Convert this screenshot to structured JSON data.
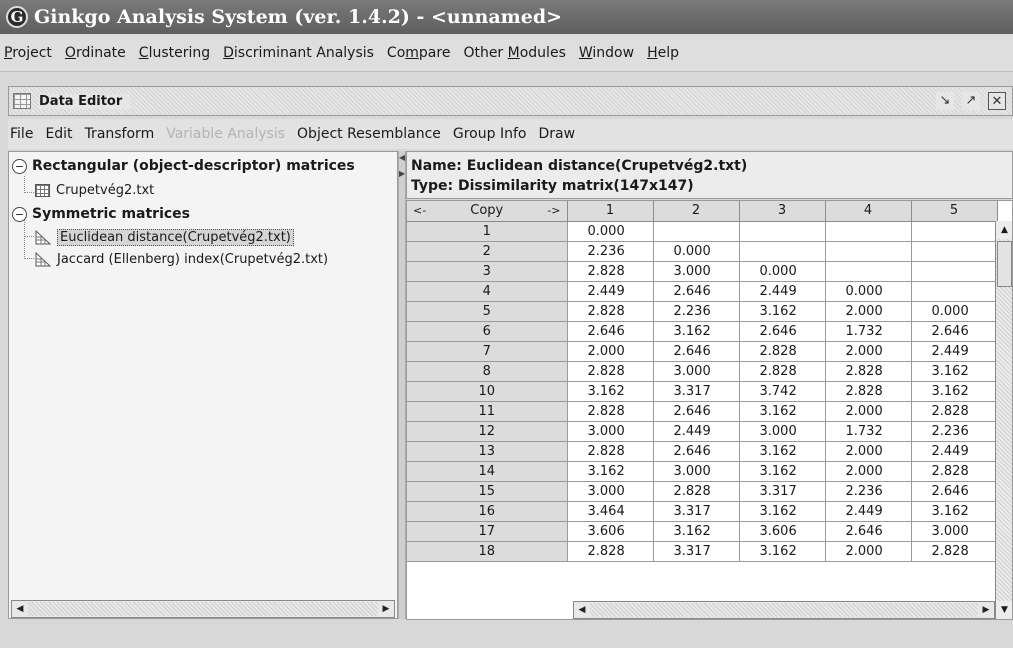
{
  "app": {
    "icon_letter": "G",
    "title": "Ginkgo Analysis System (ver. 1.4.2) - <unnamed>"
  },
  "main_menu": [
    {
      "label": "Project",
      "key": "P"
    },
    {
      "label": "Ordinate",
      "key": "O"
    },
    {
      "label": "Clustering",
      "key": "C"
    },
    {
      "label": "Discriminant Analysis",
      "key": "D"
    },
    {
      "label": "Compare",
      "key": "m"
    },
    {
      "label": "Other Modules",
      "key": "M"
    },
    {
      "label": "Window",
      "key": "W"
    },
    {
      "label": "Help",
      "key": "H"
    }
  ],
  "data_editor": {
    "title": "Data Editor",
    "window_buttons": [
      "minimize",
      "maximize",
      "close"
    ],
    "menu": [
      {
        "label": "File",
        "disabled": false
      },
      {
        "label": "Edit",
        "disabled": false
      },
      {
        "label": "Transform",
        "disabled": false
      },
      {
        "label": "Variable Analysis",
        "disabled": true
      },
      {
        "label": "Object Resemblance",
        "disabled": false
      },
      {
        "label": "Group Info",
        "disabled": false
      },
      {
        "label": "Draw",
        "disabled": false
      }
    ]
  },
  "tree": {
    "categories": [
      {
        "label": "Rectangular (object-descriptor) matrices",
        "items": [
          "Crupetvég2.txt"
        ]
      },
      {
        "label": "Symmetric matrices",
        "items": [
          "Euclidean distance(Crupetvég2.txt)",
          "Jaccard (Ellenberg) index(Crupetvég2.txt)"
        ]
      }
    ],
    "selected_item": "Euclidean distance(Crupetvég2.txt)"
  },
  "matrix": {
    "name_line": "Name: Euclidean distance(Crupetvég2.txt)",
    "type_line": "Type: Dissimilarity matrix(147x147)",
    "nav_left": "<-",
    "copy_label": "Copy",
    "nav_right": "->",
    "columns": [
      "1",
      "2",
      "3",
      "4",
      "5"
    ],
    "rows": [
      {
        "id": "1",
        "values": [
          "0.000",
          "",
          "",
          "",
          ""
        ]
      },
      {
        "id": "2",
        "values": [
          "2.236",
          "0.000",
          "",
          "",
          ""
        ]
      },
      {
        "id": "3",
        "values": [
          "2.828",
          "3.000",
          "0.000",
          "",
          ""
        ]
      },
      {
        "id": "4",
        "values": [
          "2.449",
          "2.646",
          "2.449",
          "0.000",
          ""
        ]
      },
      {
        "id": "5",
        "values": [
          "2.828",
          "2.236",
          "3.162",
          "2.000",
          "0.000"
        ]
      },
      {
        "id": "6",
        "values": [
          "2.646",
          "3.162",
          "2.646",
          "1.732",
          "2.646"
        ]
      },
      {
        "id": "7",
        "values": [
          "2.000",
          "2.646",
          "2.828",
          "2.000",
          "2.449"
        ]
      },
      {
        "id": "8",
        "values": [
          "2.828",
          "3.000",
          "2.828",
          "2.828",
          "3.162"
        ]
      },
      {
        "id": "10",
        "values": [
          "3.162",
          "3.317",
          "3.742",
          "2.828",
          "3.162"
        ]
      },
      {
        "id": "11",
        "values": [
          "2.828",
          "2.646",
          "3.162",
          "2.000",
          "2.828"
        ]
      },
      {
        "id": "12",
        "values": [
          "3.000",
          "2.449",
          "3.000",
          "1.732",
          "2.236"
        ]
      },
      {
        "id": "13",
        "values": [
          "2.828",
          "2.646",
          "3.162",
          "2.000",
          "2.449"
        ]
      },
      {
        "id": "14",
        "values": [
          "3.162",
          "3.000",
          "3.162",
          "2.000",
          "2.828"
        ]
      },
      {
        "id": "15",
        "values": [
          "3.000",
          "2.828",
          "3.317",
          "2.236",
          "2.646"
        ]
      },
      {
        "id": "16",
        "values": [
          "3.464",
          "3.317",
          "3.162",
          "2.449",
          "3.162"
        ]
      },
      {
        "id": "17",
        "values": [
          "3.606",
          "3.162",
          "3.606",
          "2.646",
          "3.000"
        ]
      },
      {
        "id": "18",
        "values": [
          "2.828",
          "3.317",
          "3.162",
          "2.000",
          "2.828"
        ]
      }
    ]
  }
}
